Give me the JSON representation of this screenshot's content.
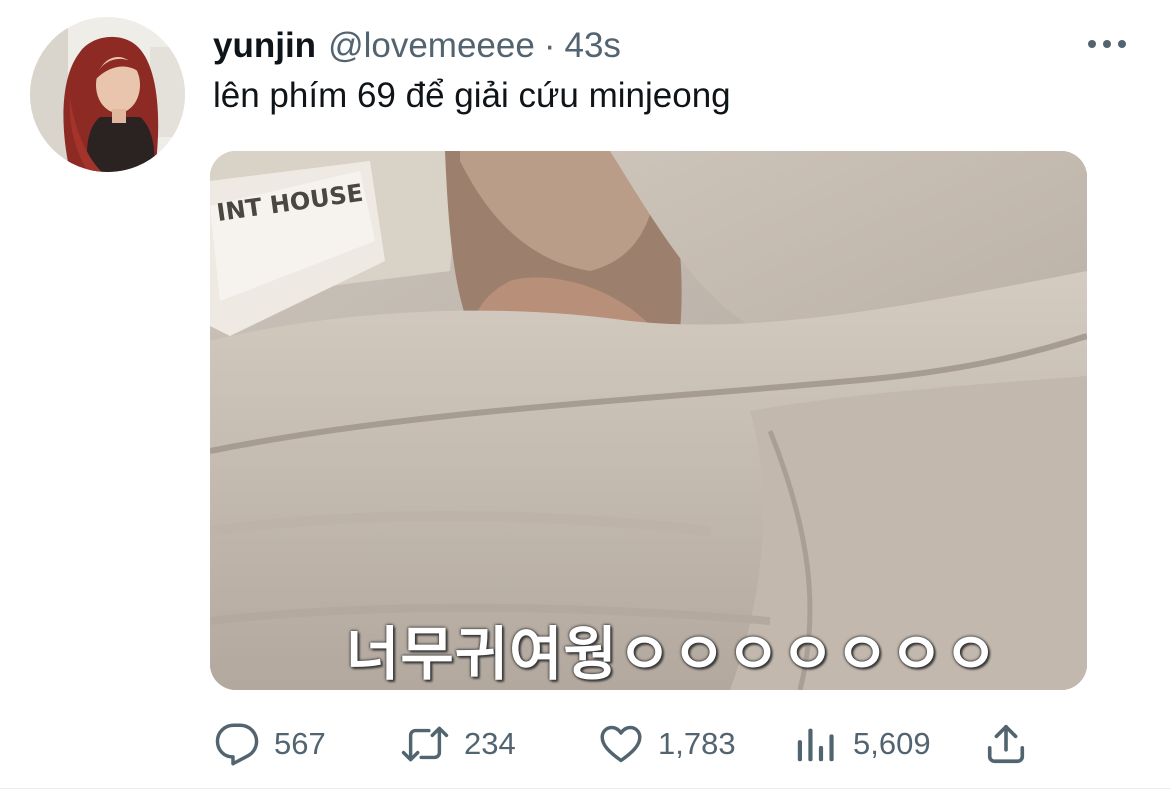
{
  "author": {
    "display_name": "yunjin",
    "handle": "@lovemeeee",
    "separator": "·",
    "time": "43s"
  },
  "tweet": {
    "text": "lên phím 69 để giải cứu minjeong",
    "media_caption": "너무귀여웡ㅇㅇㅇㅇㅇㅇㅇ",
    "media_sign_text": "INT HOUSE"
  },
  "actions": {
    "replies": "567",
    "retweets": "234",
    "likes": "1,783",
    "views": "5,609"
  },
  "icons": {
    "more": "more-horizontal-icon",
    "reply": "reply-bubble-icon",
    "retweet": "retweet-icon",
    "like": "heart-icon",
    "views": "views-bar-chart-icon",
    "share": "share-upload-icon"
  },
  "colors": {
    "text_primary": "#0f1419",
    "text_secondary": "#536471",
    "background": "#ffffff"
  }
}
